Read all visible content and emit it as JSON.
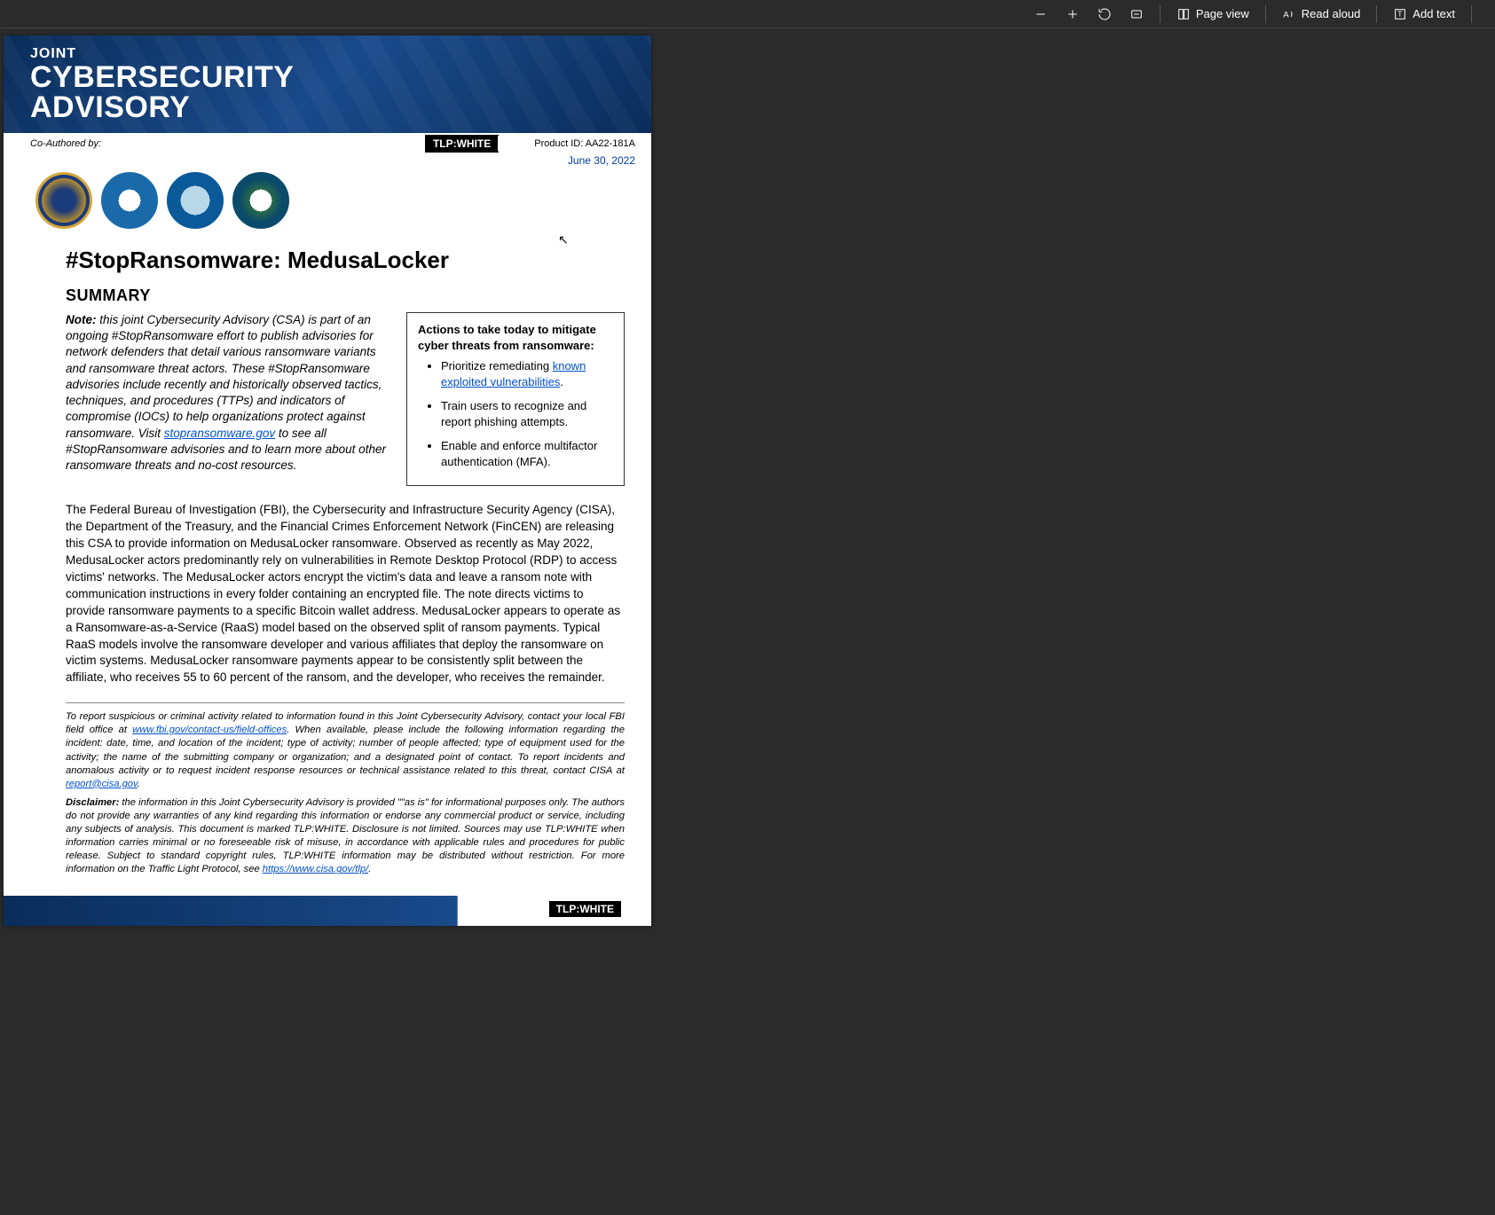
{
  "toolbar": {
    "minus_tip": "−",
    "plus_tip": "+",
    "rotate_tip": "↻",
    "fit_tip": "⤢",
    "pageview_icon": "⧉",
    "pageview_label": "Page view",
    "readaloud_icon": "A⁾",
    "readaloud_label": "Read aloud",
    "addtext_icon": "⊞",
    "addtext_label": "Add text"
  },
  "banner": {
    "joint": "JOINT",
    "line1": "CYBERSECURITY",
    "line2": "ADVISORY"
  },
  "meta": {
    "coauthored": "Co-Authored by:",
    "tlp": "TLP:WHITE",
    "product_id": "Product ID: AA22-181A",
    "date": "June 30, 2022"
  },
  "seals": [
    "FBI",
    "CISA",
    "TREASURY",
    "FinCEN"
  ],
  "title": "#StopRansomware: MedusaLocker",
  "summary_heading": "SUMMARY",
  "note": {
    "label": "Note:",
    "text_before_link": " this joint Cybersecurity Advisory (CSA) is part of an ongoing #StopRansomware effort to publish advisories for network defenders that detail various ransomware variants and ransomware threat actors. These #StopRansomware advisories include recently and historically observed tactics, techniques, and procedures (TTPs) and indicators of compromise (IOCs) to help organizations protect against ransomware. Visit ",
    "link_text": "stopransomware.gov",
    "text_after_link": " to see all #StopRansomware advisories and to learn more about other ransomware threats and no-cost resources."
  },
  "action_box": {
    "title": "Actions to take today to mitigate cyber threats from ransomware:",
    "items": [
      {
        "pre": "Prioritize remediating ",
        "link": "known exploited vulnerabilities",
        "post": "."
      },
      {
        "pre": "Train users to recognize and report phishing attempts.",
        "link": "",
        "post": ""
      },
      {
        "pre": "Enable and enforce multifactor authentication (MFA).",
        "link": "",
        "post": ""
      }
    ]
  },
  "body": "The Federal Bureau of Investigation (FBI), the Cybersecurity and Infrastructure Security Agency (CISA), the Department of the Treasury, and the Financial Crimes Enforcement Network (FinCEN) are releasing this CSA to provide information on MedusaLocker ransomware. Observed as recently as May 2022, MedusaLocker actors predominantly rely on vulnerabilities in Remote Desktop Protocol (RDP) to access victims' networks. The MedusaLocker actors encrypt the victim's data and leave a ransom note with communication instructions in every folder containing an encrypted file. The note directs victims to provide ransomware payments to a specific Bitcoin wallet address. MedusaLocker appears to operate as a Ransomware-as-a-Service (RaaS) model based on the observed split of ransom payments. Typical RaaS models involve the ransomware developer and various affiliates that deploy the ransomware on victim systems. MedusaLocker ransomware payments appear to be consistently split between the affiliate, who receives 55 to 60 percent of the ransom, and the developer, who receives the remainder.",
  "report": {
    "pre": "To report suspicious or criminal activity related to information found in this Joint Cybersecurity Advisory, contact your local FBI field office at ",
    "link1": "www.fbi.gov/contact-us/field-offices",
    "mid": ". When available, please include the following information regarding the incident: date, time, and location of the incident; type of activity; number of people affected; type of equipment used for the activity; the name of the submitting company or organization; and a designated point of contact. To report incidents and anomalous activity or to request incident response resources or technical assistance related to this threat, contact CISA at ",
    "link2": "report@cisa.gov",
    "post": "."
  },
  "disclaimer": {
    "label": "Disclaimer:",
    "text": " the information in this Joint Cybersecurity Advisory is provided \"\"as is\" for informational purposes only. The authors do not provide any warranties of any kind regarding this information or endorse any commercial product or service, including any subjects of analysis. This document is marked TLP:WHITE. Disclosure is not limited. Sources may use TLP:WHITE when information carries minimal or no foreseeable risk of misuse, in accordance with applicable rules and procedures for public release. Subject to standard copyright rules, TLP:WHITE information may be distributed without restriction. For more information on the Traffic Light Protocol, see ",
    "link": "https://www.cisa.gov/tlp/",
    "post": "."
  },
  "footer_tlp": "TLP:WHITE"
}
